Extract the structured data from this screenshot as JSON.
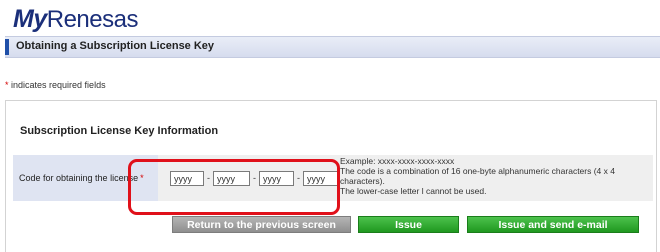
{
  "header": {
    "logo_my": "My",
    "logo_brand": "Renesas",
    "page_title": "Obtaining a Subscription License Key"
  },
  "required_note": {
    "star": "*",
    "text": " indicates required fields"
  },
  "section": {
    "title": "Subscription License Key Information"
  },
  "form": {
    "code_label": "Code for obtaining the license",
    "required_star": "*",
    "inputs": [
      {
        "value": "yyyy"
      },
      {
        "value": "yyyy"
      },
      {
        "value": "yyyy"
      },
      {
        "value": "yyyy"
      }
    ],
    "separator": "-",
    "hint_example": "Example: xxxx-xxxx-xxxx-xxxx",
    "hint_combination": "The code is a combination of 16 one-byte alphanumeric characters (4 x 4 characters).",
    "hint_lowercase": "The lower-case letter l cannot be used."
  },
  "buttons": {
    "back": "Return to the previous screen",
    "issue": "Issue",
    "issue_email": "Issue and send e-mail"
  },
  "colors": {
    "brand": "#1b2f7a",
    "highlight": "#e0101a",
    "button_green": "#1f981f",
    "button_gray": "#8f8f8f"
  }
}
